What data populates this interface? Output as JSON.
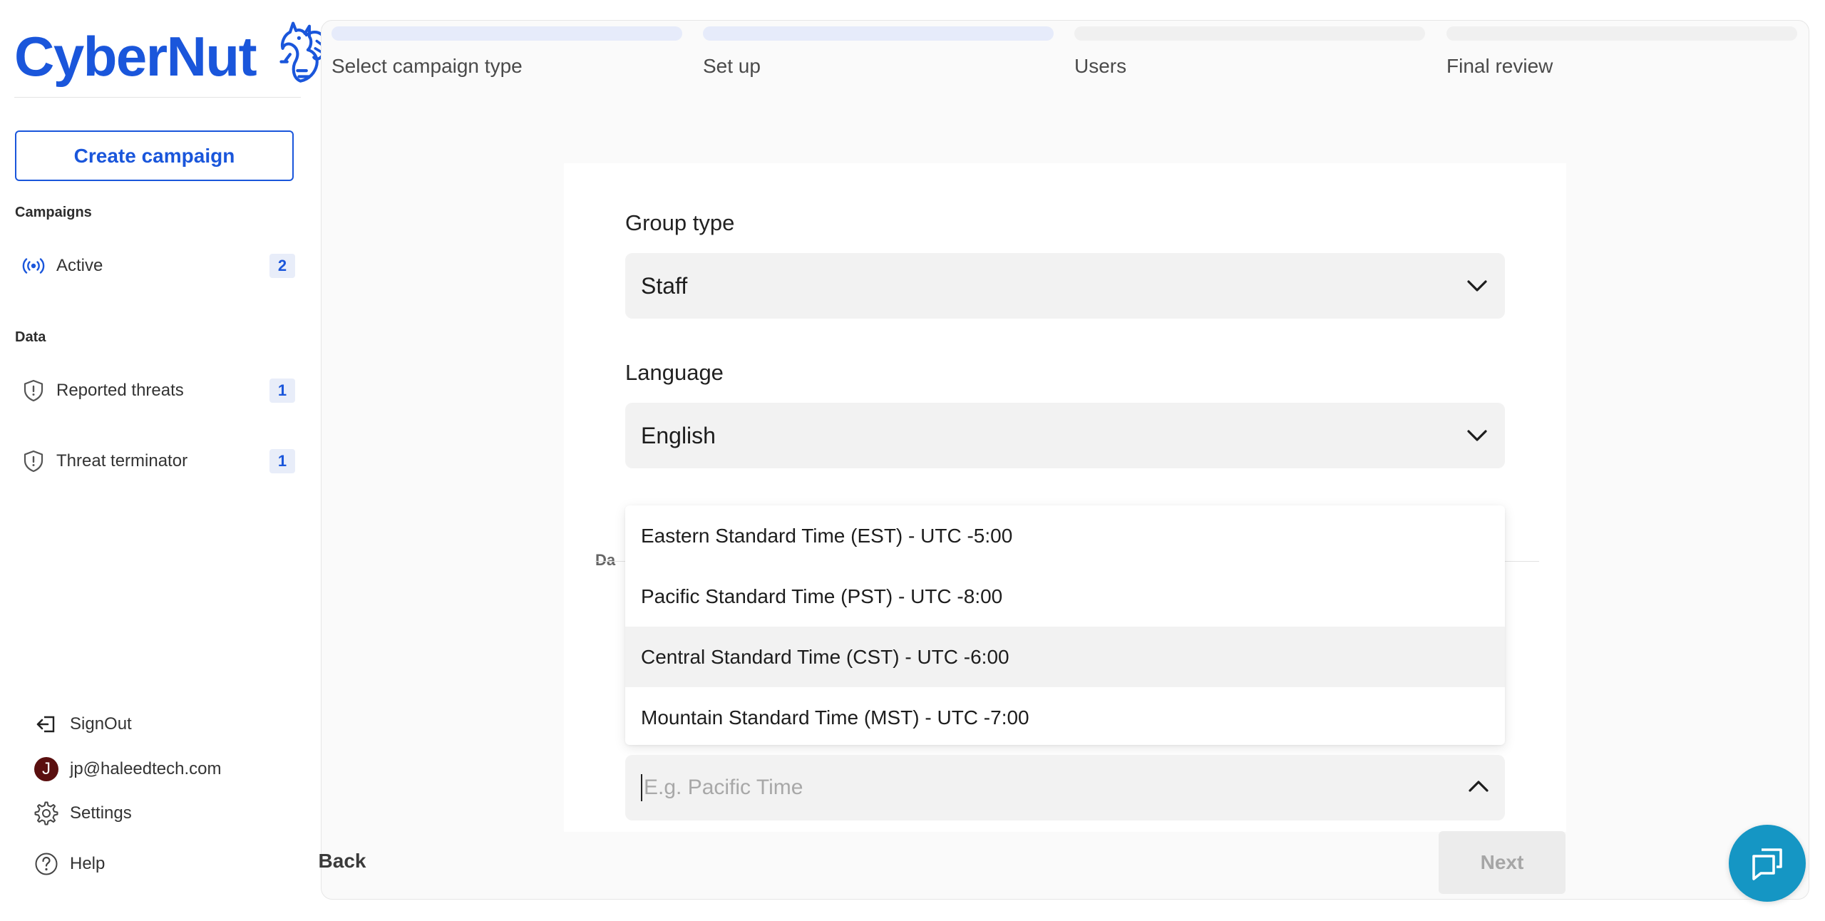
{
  "brand": {
    "name": "CyberNut",
    "color": "#1a56db"
  },
  "sidebar": {
    "create_label": "Create campaign",
    "campaigns_section": "Campaigns",
    "data_section": "Data",
    "items": [
      {
        "label": "Active",
        "count": "2",
        "icon": "broadcast-icon"
      },
      {
        "label": "Reported threats",
        "count": "1",
        "icon": "shield-icon"
      },
      {
        "label": "Threat terminator",
        "count": "1",
        "icon": "shield-icon"
      }
    ],
    "footer": {
      "signout": "SignOut",
      "user_email": "jp@haleedtech.com",
      "avatar_letter": "J",
      "settings": "Settings",
      "help": "Help"
    }
  },
  "steps": [
    {
      "label": "Select campaign type",
      "active": true
    },
    {
      "label": "Set up",
      "active": true
    },
    {
      "label": "Users",
      "active": false
    },
    {
      "label": "Final review",
      "active": false
    }
  ],
  "form": {
    "group_type": {
      "label": "Group type",
      "value": "Staff"
    },
    "language": {
      "label": "Language",
      "value": "English"
    },
    "hidden_label_fragment": "Da",
    "timezone": {
      "placeholder": "E.g. Pacific Time",
      "options": [
        "Eastern Standard Time (EST) - UTC -5:00",
        "Pacific Standard Time (PST) - UTC -8:00",
        "Central Standard Time (CST) - UTC -6:00",
        "Mountain Standard Time (MST) - UTC -7:00"
      ],
      "highlighted_index": 2
    }
  },
  "nav": {
    "back": "Back",
    "next": "Next"
  },
  "chat": {
    "icon": "chat-bubbles-icon",
    "color": "#1596c4"
  }
}
